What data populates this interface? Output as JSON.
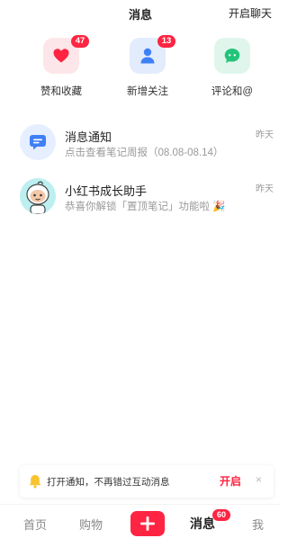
{
  "header": {
    "title": "消息",
    "action_label": "开启聊天"
  },
  "quick_actions": [
    {
      "label": "赞和收藏",
      "badge": "47",
      "icon": "heart-icon",
      "color": "#ff2442"
    },
    {
      "label": "新增关注",
      "badge": "13",
      "icon": "person-icon",
      "color": "#3f80f7"
    },
    {
      "label": "评论和@",
      "badge": "",
      "icon": "comment-icon",
      "color": "#22c47a"
    }
  ],
  "messages": [
    {
      "title": "消息通知",
      "subtitle": "点击查看笔记周报（08.08-08.14）",
      "time": "昨天",
      "icon": "notification-icon"
    },
    {
      "title": "小红书成长助手",
      "subtitle": "恭喜你解锁「置顶笔记」功能啦 🎉",
      "time": "昨天",
      "icon": "assistant-avatar"
    }
  ],
  "notification_bar": {
    "text": "打开通知，不再错过互动消息",
    "action_label": "开启",
    "close_label": "×"
  },
  "tabbar": {
    "home": "首页",
    "shop": "购物",
    "messages": "消息",
    "messages_badge": "60",
    "me": "我",
    "accent": "#ff2442"
  }
}
